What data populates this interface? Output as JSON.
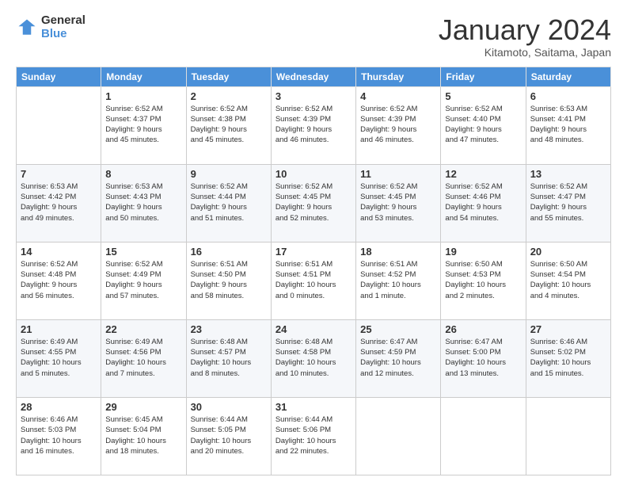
{
  "logo": {
    "general": "General",
    "blue": "Blue"
  },
  "header": {
    "month": "January 2024",
    "location": "Kitamoto, Saitama, Japan"
  },
  "weekdays": [
    "Sunday",
    "Monday",
    "Tuesday",
    "Wednesday",
    "Thursday",
    "Friday",
    "Saturday"
  ],
  "weeks": [
    [
      {
        "day": "",
        "info": ""
      },
      {
        "day": "1",
        "info": "Sunrise: 6:52 AM\nSunset: 4:37 PM\nDaylight: 9 hours\nand 45 minutes."
      },
      {
        "day": "2",
        "info": "Sunrise: 6:52 AM\nSunset: 4:38 PM\nDaylight: 9 hours\nand 45 minutes."
      },
      {
        "day": "3",
        "info": "Sunrise: 6:52 AM\nSunset: 4:39 PM\nDaylight: 9 hours\nand 46 minutes."
      },
      {
        "day": "4",
        "info": "Sunrise: 6:52 AM\nSunset: 4:39 PM\nDaylight: 9 hours\nand 46 minutes."
      },
      {
        "day": "5",
        "info": "Sunrise: 6:52 AM\nSunset: 4:40 PM\nDaylight: 9 hours\nand 47 minutes."
      },
      {
        "day": "6",
        "info": "Sunrise: 6:53 AM\nSunset: 4:41 PM\nDaylight: 9 hours\nand 48 minutes."
      }
    ],
    [
      {
        "day": "7",
        "info": "Sunrise: 6:53 AM\nSunset: 4:42 PM\nDaylight: 9 hours\nand 49 minutes."
      },
      {
        "day": "8",
        "info": "Sunrise: 6:53 AM\nSunset: 4:43 PM\nDaylight: 9 hours\nand 50 minutes."
      },
      {
        "day": "9",
        "info": "Sunrise: 6:52 AM\nSunset: 4:44 PM\nDaylight: 9 hours\nand 51 minutes."
      },
      {
        "day": "10",
        "info": "Sunrise: 6:52 AM\nSunset: 4:45 PM\nDaylight: 9 hours\nand 52 minutes."
      },
      {
        "day": "11",
        "info": "Sunrise: 6:52 AM\nSunset: 4:45 PM\nDaylight: 9 hours\nand 53 minutes."
      },
      {
        "day": "12",
        "info": "Sunrise: 6:52 AM\nSunset: 4:46 PM\nDaylight: 9 hours\nand 54 minutes."
      },
      {
        "day": "13",
        "info": "Sunrise: 6:52 AM\nSunset: 4:47 PM\nDaylight: 9 hours\nand 55 minutes."
      }
    ],
    [
      {
        "day": "14",
        "info": "Sunrise: 6:52 AM\nSunset: 4:48 PM\nDaylight: 9 hours\nand 56 minutes."
      },
      {
        "day": "15",
        "info": "Sunrise: 6:52 AM\nSunset: 4:49 PM\nDaylight: 9 hours\nand 57 minutes."
      },
      {
        "day": "16",
        "info": "Sunrise: 6:51 AM\nSunset: 4:50 PM\nDaylight: 9 hours\nand 58 minutes."
      },
      {
        "day": "17",
        "info": "Sunrise: 6:51 AM\nSunset: 4:51 PM\nDaylight: 10 hours\nand 0 minutes."
      },
      {
        "day": "18",
        "info": "Sunrise: 6:51 AM\nSunset: 4:52 PM\nDaylight: 10 hours\nand 1 minute."
      },
      {
        "day": "19",
        "info": "Sunrise: 6:50 AM\nSunset: 4:53 PM\nDaylight: 10 hours\nand 2 minutes."
      },
      {
        "day": "20",
        "info": "Sunrise: 6:50 AM\nSunset: 4:54 PM\nDaylight: 10 hours\nand 4 minutes."
      }
    ],
    [
      {
        "day": "21",
        "info": "Sunrise: 6:49 AM\nSunset: 4:55 PM\nDaylight: 10 hours\nand 5 minutes."
      },
      {
        "day": "22",
        "info": "Sunrise: 6:49 AM\nSunset: 4:56 PM\nDaylight: 10 hours\nand 7 minutes."
      },
      {
        "day": "23",
        "info": "Sunrise: 6:48 AM\nSunset: 4:57 PM\nDaylight: 10 hours\nand 8 minutes."
      },
      {
        "day": "24",
        "info": "Sunrise: 6:48 AM\nSunset: 4:58 PM\nDaylight: 10 hours\nand 10 minutes."
      },
      {
        "day": "25",
        "info": "Sunrise: 6:47 AM\nSunset: 4:59 PM\nDaylight: 10 hours\nand 12 minutes."
      },
      {
        "day": "26",
        "info": "Sunrise: 6:47 AM\nSunset: 5:00 PM\nDaylight: 10 hours\nand 13 minutes."
      },
      {
        "day": "27",
        "info": "Sunrise: 6:46 AM\nSunset: 5:02 PM\nDaylight: 10 hours\nand 15 minutes."
      }
    ],
    [
      {
        "day": "28",
        "info": "Sunrise: 6:46 AM\nSunset: 5:03 PM\nDaylight: 10 hours\nand 16 minutes."
      },
      {
        "day": "29",
        "info": "Sunrise: 6:45 AM\nSunset: 5:04 PM\nDaylight: 10 hours\nand 18 minutes."
      },
      {
        "day": "30",
        "info": "Sunrise: 6:44 AM\nSunset: 5:05 PM\nDaylight: 10 hours\nand 20 minutes."
      },
      {
        "day": "31",
        "info": "Sunrise: 6:44 AM\nSunset: 5:06 PM\nDaylight: 10 hours\nand 22 minutes."
      },
      {
        "day": "",
        "info": ""
      },
      {
        "day": "",
        "info": ""
      },
      {
        "day": "",
        "info": ""
      }
    ]
  ]
}
